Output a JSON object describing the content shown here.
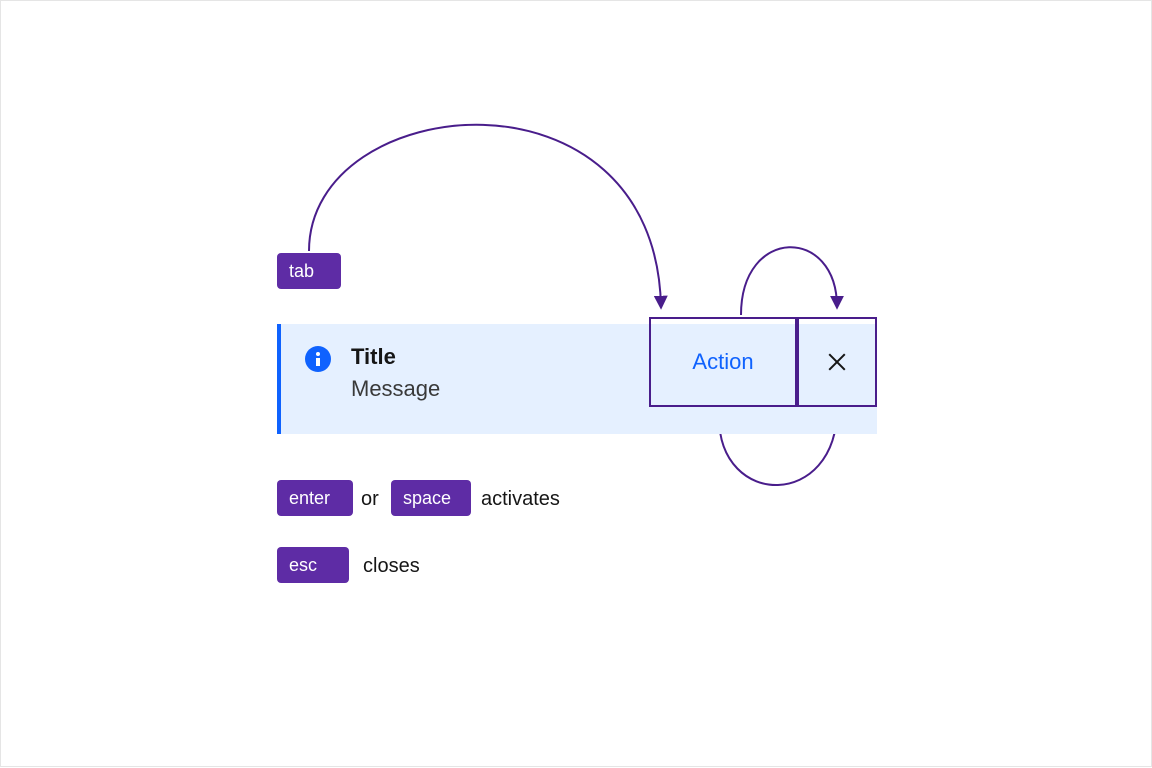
{
  "keys": {
    "tab": "tab",
    "enter": "enter",
    "space": "space",
    "esc": "esc"
  },
  "hints": {
    "or": "or",
    "activates": "activates",
    "closes": "closes"
  },
  "notification": {
    "icon_name": "info-icon",
    "title": "Title",
    "message": "Message",
    "action_label": "Action",
    "close_icon_name": "close-icon"
  },
  "colors": {
    "purple": "#5e2ca5",
    "blue": "#0f62fe",
    "outline": "#491d8b",
    "panel_bg": "#e5f0ff"
  }
}
